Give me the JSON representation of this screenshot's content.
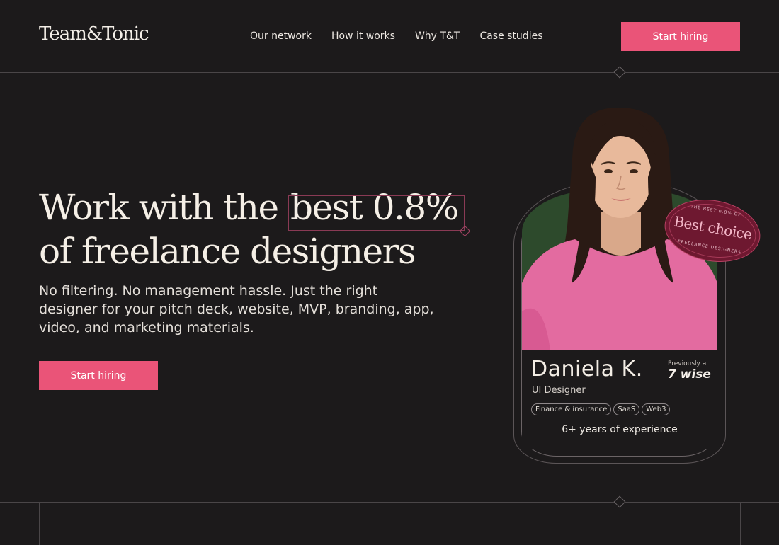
{
  "header": {
    "logo": "Team&Tonic",
    "nav": [
      {
        "label": "Our network"
      },
      {
        "label": "How it works"
      },
      {
        "label": "Why T&T"
      },
      {
        "label": "Case studies"
      }
    ],
    "cta": "Start hiring"
  },
  "hero": {
    "title_before": "Work with the ",
    "title_highlight": "best 0.8%",
    "title_line2": "of freelance designers",
    "subtitle": "No filtering. No management hassle. Just the right designer for your pitch deck, website, MVP, branding, app, video, and marketing materials.",
    "cta": "Start hiring"
  },
  "profile": {
    "name": "Daniela K.",
    "role": "UI Designer",
    "previously_label": "Previously at",
    "previous_company": "7 wise",
    "tags": [
      "Finance & insurance",
      "SaaS",
      "Web3"
    ],
    "experience": "6+ years of experience"
  },
  "badge": {
    "top": "THE BEST 0.8% OF",
    "main": "Best choice",
    "bottom": "FREELANCE DESIGNERS"
  },
  "colors": {
    "background": "#1c1a1b",
    "accent": "#ea5478",
    "badge": "#6e1830",
    "photo_backdrop": "#2d4a2c",
    "sweater": "#e36ba0"
  },
  "icons": [
    "diamond-marker-icon"
  ]
}
